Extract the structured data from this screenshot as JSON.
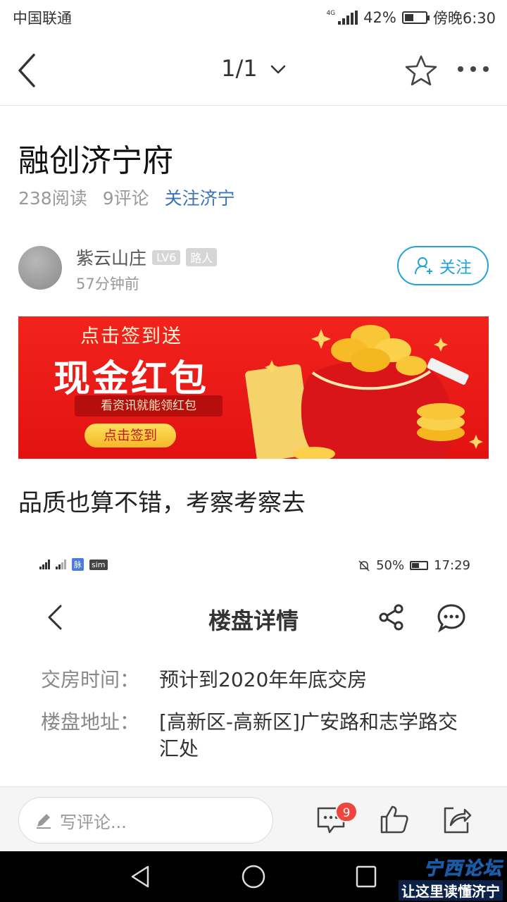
{
  "status_bar": {
    "carrier": "中国联通",
    "network": "4G",
    "battery_pct": "42%",
    "battery_level": 0.42,
    "time": "傍晚6:30"
  },
  "nav": {
    "page_indicator": "1/1"
  },
  "article": {
    "title": "融创济宁府",
    "reads": "238阅读",
    "comments": "9评论",
    "forum_link": "关注济宁"
  },
  "author": {
    "name": "紫云山庄",
    "level": "LV6",
    "role": "路人",
    "time": "57分钟前",
    "follow_label": "关注"
  },
  "banner": {
    "line1": "点击签到送",
    "headline": "现金红包",
    "subline": "看资讯就能领红包",
    "button": "点击签到"
  },
  "post": {
    "text": "品质也算不错，考察考察去"
  },
  "embedded_screenshot": {
    "status": {
      "network1": "4G",
      "network2": "4G",
      "badge1": "脉",
      "badge2": "sim",
      "battery_pct": "50%",
      "battery_level": 0.5,
      "time": "17:29"
    },
    "title": "楼盘详情",
    "rows": [
      {
        "label": "交房时间：",
        "value": "预计到2020年年底交房"
      },
      {
        "label": "楼盘地址：",
        "value": "[高新区-高新区]广安路和志学路交汇处"
      }
    ]
  },
  "bottom_bar": {
    "comment_placeholder": "写评论...",
    "comment_count": "9"
  },
  "watermark": {
    "line1": "宁西论坛",
    "line2": "让这里读懂济宁"
  },
  "colors": {
    "accent_blue": "#20a4d8",
    "link_blue": "#3b73b9",
    "banner_red": "#e21212",
    "badge_red": "#f0453c"
  }
}
